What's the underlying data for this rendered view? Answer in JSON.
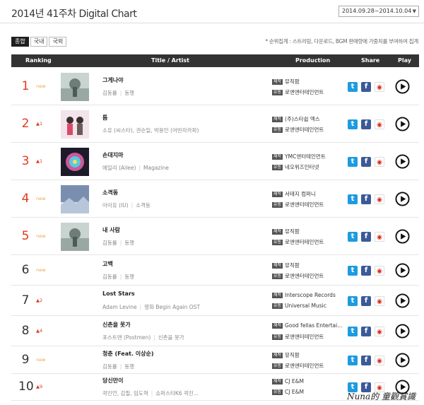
{
  "header": {
    "title": "2014년 41주차 Digital Chart",
    "period": "2014.09.28~2014.10.04"
  },
  "tabs": [
    "종합",
    "국내",
    "국외"
  ],
  "note": "* 순위집계 : 스트리밍, 다운로드, BGM 판매량에 가중치를 부여하여 집계",
  "columns": {
    "ranking": "Ranking",
    "title": "Title / Artist",
    "production": "Production",
    "share": "Share",
    "play": "Play"
  },
  "prod_labels": {
    "make": "제작",
    "dist": "유통"
  },
  "rows": [
    {
      "rank": "1",
      "change": "new",
      "title": "그게나야",
      "artist": [
        "김동률",
        "동행"
      ],
      "make": "뮤직팜",
      "dist": "로엔엔터테인먼트",
      "thumb": true
    },
    {
      "rank": "2",
      "change": "▲1",
      "title": "틈",
      "artist": [
        "소유 (씨스타), 권순일, 박용인 (어반자카파)",
        ""
      ],
      "make": "(주)스타쉽 엑스",
      "dist": "로엔엔터테인먼트",
      "thumb": true
    },
    {
      "rank": "3",
      "change": "▲1",
      "title": "손대지마",
      "artist": [
        "에일리 (Ailee)",
        "Magazine"
      ],
      "make": "YMC엔터테인먼트",
      "dist": "네오위즈인터넷",
      "thumb": true
    },
    {
      "rank": "4",
      "change": "new",
      "title": "소격동",
      "artist": [
        "아이유 (IU)",
        "소격동"
      ],
      "make": "서태지 컴퍼니",
      "dist": "로엔엔터테인먼트",
      "thumb": true
    },
    {
      "rank": "5",
      "change": "new",
      "title": "내 사람",
      "artist": [
        "김동률",
        "동행"
      ],
      "make": "뮤직팜",
      "dist": "로엔엔터테인먼트",
      "thumb": true
    },
    {
      "rank": "6",
      "change": "new",
      "title": "고백",
      "artist": [
        "김동률",
        "동행"
      ],
      "make": "뮤직팜",
      "dist": "로엔엔터테인먼트",
      "thumb": false
    },
    {
      "rank": "7",
      "change": "▲2",
      "title": "Lost Stars",
      "artist": [
        "Adam Levine",
        "영화 Begin Again OST"
      ],
      "make": "Interscope Records",
      "dist": "Universal Music",
      "thumb": false
    },
    {
      "rank": "8",
      "change": "▲4",
      "title": "신촌을 못가",
      "artist": [
        "포스트맨 (Postmen)",
        "신촌을 못가"
      ],
      "make": "Good fellas Entertai...",
      "dist": "로엔엔터테인먼트",
      "thumb": false
    },
    {
      "rank": "9",
      "change": "new",
      "title": "청춘 (Feat. 이상순)",
      "artist": [
        "김동률",
        "동행"
      ],
      "make": "뮤직팜",
      "dist": "로엔엔터테인먼트",
      "thumb": false
    },
    {
      "rank": "10",
      "change": "▲9",
      "title": "당신만이",
      "artist": [
        "곽진언, 김필, 임도혁",
        "슈퍼스타K6 곽진..."
      ],
      "make": "CJ E&M",
      "dist": "CJ E&M",
      "thumb": false
    }
  ],
  "watermark": "Nuna的 童觀賞識",
  "colors": {
    "accent": "#e03a1c",
    "new": "#f0a050",
    "twitter": "#1d9be0",
    "facebook": "#3b5a98"
  }
}
